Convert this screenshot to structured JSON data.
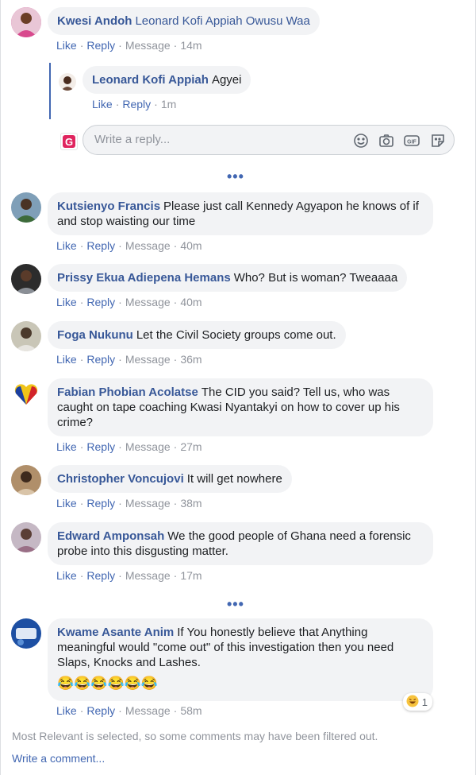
{
  "comments": [
    {
      "name": "Kwesi Andoh",
      "text": "Leonard Kofi Appiah Owusu Waa",
      "like": "Like",
      "reply": "Reply",
      "message": "Message",
      "time": "14m"
    },
    {
      "name": "Kutsienyo Francis",
      "text": "Please just call Kennedy Agyapon he knows of if and stop waisting our time",
      "like": "Like",
      "reply": "Reply",
      "message": "Message",
      "time": "40m"
    },
    {
      "name": "Prissy Ekua Adiepena Hemans",
      "text": "Who? But is woman? Tweaaaa",
      "like": "Like",
      "reply": "Reply",
      "message": "Message",
      "time": "40m"
    },
    {
      "name": "Foga Nukunu",
      "text": "Let the Civil Society groups come out.",
      "like": "Like",
      "reply": "Reply",
      "message": "Message",
      "time": "36m"
    },
    {
      "name": "Fabian Phobian Acolatse",
      "text": "The CID you said? Tell us, who was caught on tape coaching Kwasi Nyantakyi on how to cover up his crime?",
      "like": "Like",
      "reply": "Reply",
      "message": "Message",
      "time": "27m"
    },
    {
      "name": "Christopher Voncujovi",
      "text": "It will get nowhere",
      "like": "Like",
      "reply": "Reply",
      "message": "Message",
      "time": "38m"
    },
    {
      "name": "Edward Amponsah",
      "text": "We the good people of Ghana need a forensic probe into this disgusting matter.",
      "like": "Like",
      "reply": "Reply",
      "message": "Message",
      "time": "17m"
    },
    {
      "name": "Kwame Asante Anim",
      "text": "If You honestly believe that Anything meaningful would \"come out\" of this investigation then you need Slaps, Knocks and Lashes.",
      "emojis": "😂😂😂😂😂😂",
      "like": "Like",
      "reply": "Reply",
      "message": "Message",
      "time": "58m",
      "reaction_count": "1"
    }
  ],
  "reply": {
    "name": "Leonard Kofi Appiah",
    "text": "Agyei",
    "like": "Like",
    "reply": "Reply",
    "time": "1m"
  },
  "reply_box": {
    "placeholder": "Write a reply..."
  },
  "more_dots": "•••",
  "footer_note": "Most Relevant is selected, so some comments may have been filtered out.",
  "write_comment": "Write a comment...",
  "colors": {
    "link": "#385898",
    "action": "#4267b2",
    "bubble": "#f2f3f5",
    "muted": "#90949c"
  }
}
